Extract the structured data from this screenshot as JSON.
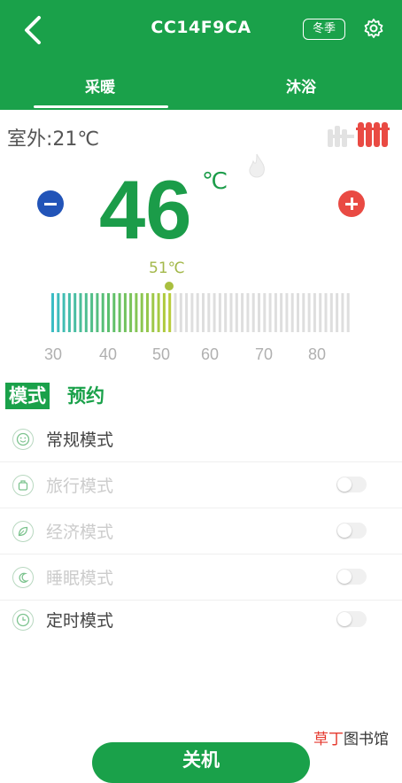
{
  "header": {
    "title": "CC14F9CA",
    "season_badge": "冬季",
    "back_icon": "back-chevron-icon",
    "settings_icon": "gear-icon"
  },
  "tabs": [
    {
      "label": "采暖",
      "active": true
    },
    {
      "label": "沐浴",
      "active": false
    }
  ],
  "outdoor": {
    "text": "室外:21℃"
  },
  "temperature": {
    "current": "46",
    "unit": "℃",
    "setpoint_label": "51℃",
    "scale_ticks": [
      "30",
      "40",
      "50",
      "60",
      "70",
      "80"
    ],
    "setpoint_value": 51,
    "scale_min": 30,
    "scale_max": 84
  },
  "mode_tabs": [
    {
      "label": "模式",
      "active": true
    },
    {
      "label": "预约",
      "active": false
    }
  ],
  "modes": [
    {
      "label": "常规模式",
      "icon": "smile-icon",
      "has_toggle": false,
      "faded": false
    },
    {
      "label": "旅行模式",
      "icon": "luggage-icon",
      "has_toggle": true,
      "faded": true
    },
    {
      "label": "经济模式",
      "icon": "leaf-icon",
      "has_toggle": true,
      "faded": true
    },
    {
      "label": "睡眠模式",
      "icon": "moon-icon",
      "has_toggle": true,
      "faded": true
    },
    {
      "label": "定时模式",
      "icon": "clock-icon",
      "has_toggle": true,
      "faded": false
    }
  ],
  "power_button": {
    "label": "关机"
  },
  "watermark": {
    "part1": "草丁",
    "part2": "图书馆"
  },
  "colors": {
    "brand_green": "#1aa14a",
    "minus_blue": "#2254b8",
    "plus_red": "#e94a43",
    "setpoint_yellow": "#a3b84a"
  }
}
